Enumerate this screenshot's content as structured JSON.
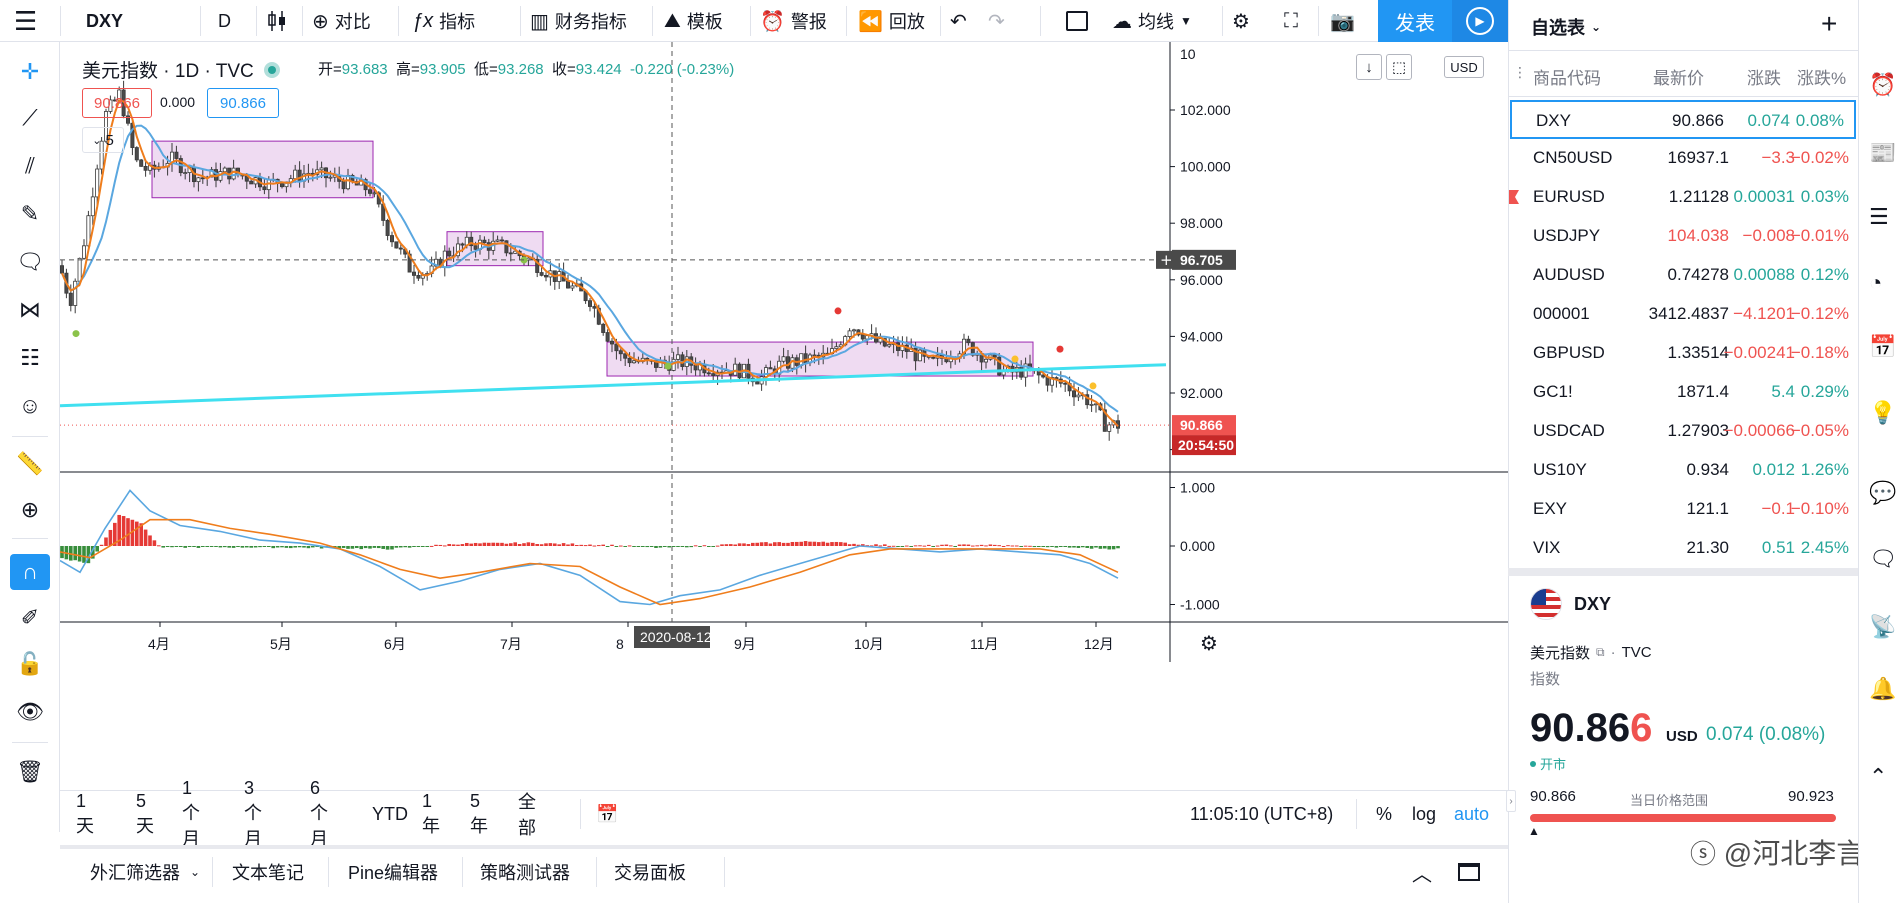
{
  "toolbar": {
    "symbol": "DXY",
    "interval": "D",
    "compare": "对比",
    "indicators": "指标",
    "financials": "财务指标",
    "templates": "模板",
    "alert": "警报",
    "replay": "回放",
    "ma": "均线",
    "publish": "发表"
  },
  "legend": {
    "title": "美元指数 · 1D · TVC",
    "open_label": "开=",
    "open": "93.683",
    "high_label": "高=",
    "high": "93.905",
    "low_label": "低=",
    "low": "93.268",
    "close_label": "收=",
    "close": "93.424",
    "change": "-0.220 (-0.23%)",
    "bid": "90.866",
    "spread": "0.000",
    "ask": "90.866",
    "collapse_count": "5"
  },
  "price_axis": {
    "currency": "USD",
    "ticks": [
      "102.000",
      "100.000",
      "98.000",
      "96.000",
      "94.000",
      "92.000",
      "90.000"
    ],
    "crosshair_price": "96.705",
    "last_price": "90.866",
    "countdown": "20:54:50",
    "top_partial": "10"
  },
  "macd_axis": {
    "ticks": [
      "1.000",
      "0.000",
      "-1.000"
    ]
  },
  "time_axis": {
    "labels": [
      "4月",
      "5月",
      "6月",
      "7月",
      "8",
      "9月",
      "10月",
      "11月",
      "12月"
    ],
    "crosshair_date": "2020-08-12"
  },
  "ranges": {
    "items": [
      "1天",
      "5天",
      "1个月",
      "3个月",
      "6个月",
      "YTD",
      "1年",
      "5年",
      "全部"
    ],
    "clock": "11:05:10 (UTC+8)",
    "percent": "%",
    "log": "log",
    "auto": "auto"
  },
  "panels": [
    "外汇筛选器",
    "文本笔记",
    "Pine编辑器",
    "策略测试器",
    "交易面板"
  ],
  "watchlist": {
    "title": "自选表",
    "headers": [
      "商品代码",
      "最新价",
      "涨跌",
      "涨跌%"
    ],
    "rows": [
      {
        "symbol": "DXY",
        "price": "90.866",
        "change": "0.074",
        "pct": "0.08%",
        "dir": "pos",
        "pcolor": "#131722"
      },
      {
        "symbol": "CN50USD",
        "price": "16937.1",
        "change": "−3.3",
        "pct": "−0.02%",
        "dir": "neg",
        "pcolor": "#131722"
      },
      {
        "symbol": "EURUSD",
        "price": "1.21128",
        "change": "0.00031",
        "pct": "0.03%",
        "dir": "pos",
        "pcolor": "#131722"
      },
      {
        "symbol": "USDJPY",
        "price": "104.038",
        "change": "−0.008",
        "pct": "−0.01%",
        "dir": "neg",
        "pcolor": "#ef5350"
      },
      {
        "symbol": "AUDUSD",
        "price": "0.74278",
        "change": "0.00088",
        "pct": "0.12%",
        "dir": "pos",
        "pcolor": "#131722"
      },
      {
        "symbol": "000001",
        "price": "3412.4837",
        "change": "−4.1201",
        "pct": "−0.12%",
        "dir": "neg",
        "pcolor": "#131722"
      },
      {
        "symbol": "GBPUSD",
        "price": "1.33514",
        "change": "−0.00241",
        "pct": "−0.18%",
        "dir": "neg",
        "pcolor": "#131722"
      },
      {
        "symbol": "GC1!",
        "price": "1871.4",
        "change": "5.4",
        "pct": "0.29%",
        "dir": "pos",
        "pcolor": "#131722"
      },
      {
        "symbol": "USDCAD",
        "price": "1.27903",
        "change": "−0.00066",
        "pct": "−0.05%",
        "dir": "neg",
        "pcolor": "#131722"
      },
      {
        "symbol": "US10Y",
        "price": "0.934",
        "change": "0.012",
        "pct": "1.26%",
        "dir": "pos",
        "pcolor": "#131722"
      },
      {
        "symbol": "EXY",
        "price": "121.1",
        "change": "−0.1",
        "pct": "−0.10%",
        "dir": "neg",
        "pcolor": "#131722"
      },
      {
        "symbol": "VIX",
        "price": "21.30",
        "change": "0.51",
        "pct": "2.45%",
        "dir": "pos",
        "pcolor": "#131722"
      }
    ]
  },
  "details": {
    "symbol": "DXY",
    "name": "美元指数",
    "exchange": "TVC",
    "type": "指数",
    "price_main": "90.86",
    "price_last_digit": "6",
    "currency": "USD",
    "change": "0.074 (0.08%)",
    "market_status": "开市",
    "range_low": "90.866",
    "range_label": "当日价格范围",
    "range_high": "90.923"
  },
  "watermark": "@河北李言",
  "colors": {
    "accent": "#2196f3",
    "up": "#26a69a",
    "down": "#ef5350",
    "box_fill": "#e1bee7",
    "trendline": "#40e0f0",
    "ma_fast": "#ef7d1c",
    "ma_slow": "#5aa7e0",
    "macd_pos": "#e53935",
    "macd_neg": "#388e3c"
  }
}
